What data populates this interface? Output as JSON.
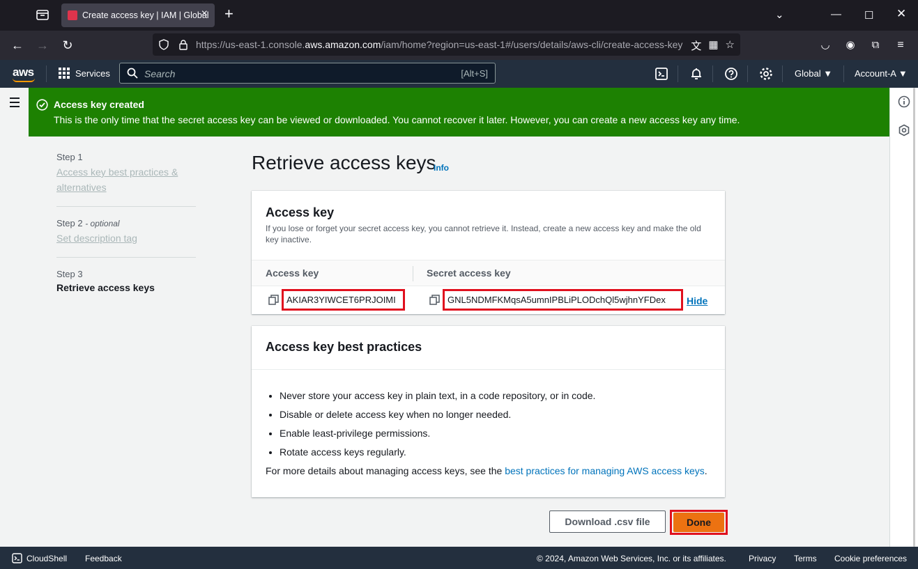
{
  "browser": {
    "tab_title": "Create access key | IAM | Global",
    "url_prefix": "https://us-east-1.console.",
    "url_domain": "aws.amazon.com",
    "url_path": "/iam/home?region=us-east-1#/users/details/aws-cli/create-access-key"
  },
  "aws_nav": {
    "logo": "aws",
    "services_label": "Services",
    "search_placeholder": "Search",
    "search_shortcut": "[Alt+S]",
    "region": "Global ▼",
    "account": "Account-A ▼"
  },
  "flash": {
    "title": "Access key created",
    "message": "This is the only time that the secret access key can be viewed or downloaded. You cannot recover it later. However, you can create a new access key any time."
  },
  "steps": [
    {
      "number": "Step 1",
      "label": "Access key best practices & alternatives"
    },
    {
      "number": "Step 2",
      "optional": "- optional",
      "label": "Set description tag"
    },
    {
      "number": "Step 3",
      "label": "Retrieve access keys"
    }
  ],
  "page": {
    "title": "Retrieve access keys",
    "info": "Info"
  },
  "access_key_card": {
    "title": "Access key",
    "description": "If you lose or forget your secret access key, you cannot retrieve it. Instead, create a new access key and make the old key inactive.",
    "col_access_key": "Access key",
    "col_secret": "Secret access key",
    "access_key_value": "AKIAR3YIWCET6PRJOIMI",
    "secret_value": "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",
    "hide_label": "Hide"
  },
  "best_practices": {
    "title": "Access key best practices",
    "items": [
      "Never store your access key in plain text, in a code repository, or in code.",
      "Disable or delete access key when no longer needed.",
      "Enable least-privilege permissions.",
      "Rotate access keys regularly."
    ],
    "more_prefix": "For more details about managing access keys, see the ",
    "more_link": "best practices for managing AWS access keys",
    "more_suffix": "."
  },
  "actions": {
    "download": "Download .csv file",
    "done": "Done"
  },
  "footer": {
    "cloudshell": "CloudShell",
    "feedback": "Feedback",
    "copyright": "© 2024, Amazon Web Services, Inc. or its affiliates.",
    "privacy": "Privacy",
    "terms": "Terms",
    "cookies": "Cookie preferences"
  },
  "colors": {
    "success_green": "#1d8102",
    "aws_nav": "#232f3e",
    "primary_orange": "#ec7211",
    "link_blue": "#0073bb",
    "highlight_red": "#e0101e"
  }
}
